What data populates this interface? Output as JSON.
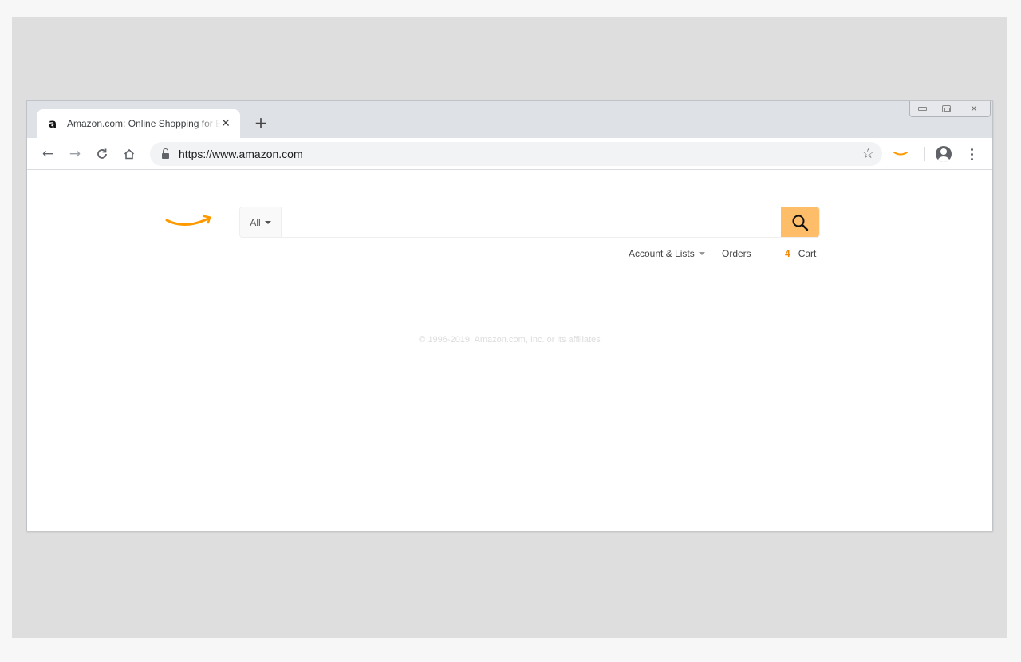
{
  "browser": {
    "tab": {
      "title": "Amazon.com: Online Shopping for Electronics, Apparel",
      "favicon_glyph": "a"
    },
    "address_bar": {
      "url": "https://www.amazon.com"
    }
  },
  "page": {
    "search": {
      "department": "All",
      "query": ""
    },
    "nav": {
      "account": "Account & Lists",
      "orders": "Orders",
      "cart_count": "4",
      "cart": "Cart"
    },
    "footer": {
      "copyright": "© 1996-2019, Amazon.com, Inc. or its affiliates"
    }
  },
  "colors": {
    "amazon_orange": "#ff9900",
    "search_button": "#febd69",
    "cart_count": "#f08804",
    "chrome_frame": "#dee1e6"
  },
  "icons": [
    "back-arrow-icon",
    "forward-arrow-icon",
    "reload-icon",
    "home-icon",
    "lock-icon",
    "star-icon",
    "amazon-extension-icon",
    "profile-icon",
    "menu-icon",
    "search-icon",
    "close-icon",
    "plus-icon"
  ]
}
